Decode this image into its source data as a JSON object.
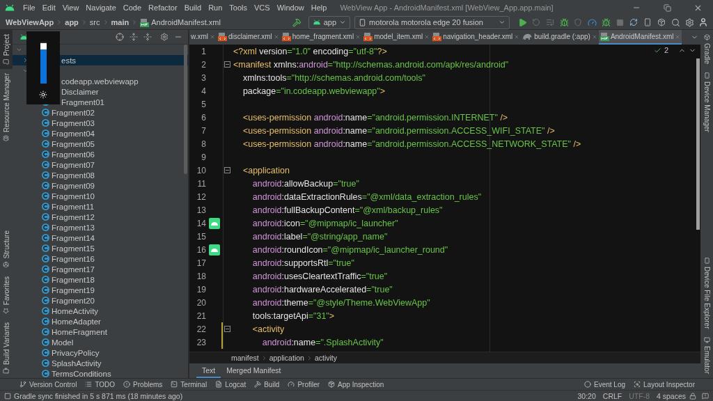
{
  "menu_bar": {
    "items": [
      "File",
      "Edit",
      "View",
      "Navigate",
      "Code",
      "Refactor",
      "Build",
      "Run",
      "Tools",
      "VCS",
      "Window",
      "Help"
    ],
    "title": "WebView App - AndroidManifest.xml [WebView_App.app.main]"
  },
  "navigation_bar": {
    "breadcrumb": [
      "WebViewApp",
      "app",
      "src",
      "main",
      "AndroidManifest.xml"
    ],
    "module": "app",
    "device": "motorola motorola edge 20 fusion"
  },
  "left_strip": {
    "top": [
      {
        "label": "Project",
        "selected": true
      },
      {
        "label": "Resource Manager",
        "selected": false
      }
    ],
    "bottom": [
      {
        "label": "Structure",
        "selected": false
      },
      {
        "label": "Favorites",
        "selected": false
      },
      {
        "label": "Build Variants",
        "selected": false
      }
    ]
  },
  "right_strip": {
    "top": [
      {
        "label": "Gradle"
      },
      {
        "label": "Device Manager"
      }
    ],
    "bottom": [
      {
        "label": "Device File Explorer"
      },
      {
        "label": "Emulator"
      }
    ]
  },
  "brightness_popup": {
    "level": 0.92
  },
  "project_tree": [
    {
      "expanded": true,
      "selected": false,
      "children": [
        {
          "label": "ests",
          "expanded": false,
          "selected": true
        },
        {
          "expanded": true,
          "selected": false,
          "children": [
            {
              "label": "codeapp.webviewapp",
              "selected": false,
              "children": [
                {
                  "label": "Disclaimer",
                  "selected": false
                },
                {
                  "label": "Fragment01",
                  "selected": false
                },
                {
                  "label": "Fragment02",
                  "selected": false
                },
                {
                  "label": "Fragment03",
                  "selected": false
                },
                {
                  "label": "Fragment04",
                  "selected": false
                },
                {
                  "label": "Fragment05",
                  "selected": false
                },
                {
                  "label": "Fragment06",
                  "selected": false
                },
                {
                  "label": "Fragment07",
                  "selected": false
                },
                {
                  "label": "Fragment08",
                  "selected": false
                },
                {
                  "label": "Fragment09",
                  "selected": false
                },
                {
                  "label": "Fragment10",
                  "selected": false
                },
                {
                  "label": "Fragment11",
                  "selected": false
                },
                {
                  "label": "Fragment12",
                  "selected": false
                },
                {
                  "label": "Fragment13",
                  "selected": false
                },
                {
                  "label": "Fragment14",
                  "selected": false
                },
                {
                  "label": "Fragment15",
                  "selected": false
                },
                {
                  "label": "Fragment16",
                  "selected": false
                },
                {
                  "label": "Fragment17",
                  "selected": false
                },
                {
                  "label": "Fragment18",
                  "selected": false
                },
                {
                  "label": "Fragment19",
                  "selected": false
                },
                {
                  "label": "Fragment20",
                  "selected": false
                },
                {
                  "label": "HomeActivity",
                  "selected": false
                },
                {
                  "label": "HomeAdapter",
                  "selected": false
                },
                {
                  "label": "HomeFragment",
                  "selected": false
                },
                {
                  "label": "Model",
                  "selected": false
                },
                {
                  "label": "PrivacyPolicy",
                  "selected": false
                },
                {
                  "label": "SplashActivity",
                  "selected": false
                },
                {
                  "label": "TermsConditions",
                  "selected": false
                }
              ]
            }
          ]
        }
      ]
    }
  ],
  "editor_tabs": [
    {
      "label": "w.xml",
      "kind": "cut",
      "selected": false
    },
    {
      "label": "disclaimer.xml",
      "kind": "xml",
      "selected": false
    },
    {
      "label": "home_fragment.xml",
      "kind": "xml",
      "selected": false
    },
    {
      "label": "model_item.xml",
      "kind": "xml",
      "selected": false
    },
    {
      "label": "navigation_header.xml",
      "kind": "xml",
      "selected": false
    },
    {
      "label": "build.gradle (:app)",
      "kind": "gradle",
      "selected": false
    },
    {
      "label": "AndroidManifest.xml",
      "kind": "manifest",
      "selected": true
    }
  ],
  "inspection_count": "2",
  "code_lines": [
    {
      "number": "1",
      "kind": "plain",
      "changed": false,
      "tokens": [
        {
          "kind": "tag",
          "text": "<?xml"
        },
        {
          "kind": "attr",
          "text": " version"
        },
        {
          "kind": "value",
          "text": "=\"1.0\""
        },
        {
          "kind": "attr",
          "text": " encoding"
        },
        {
          "kind": "value",
          "text": "=\"utf-8\""
        },
        {
          "kind": "tag",
          "text": "?>"
        }
      ]
    },
    {
      "number": "2",
      "kind": "fold",
      "changed": false,
      "tokens": [
        {
          "kind": "tag",
          "text": "<manifest"
        },
        {
          "kind": "attr",
          "text": " xmlns:"
        },
        {
          "kind": "ns",
          "text": "android"
        },
        {
          "kind": "value",
          "text": "=\"http://schemas.android.com/apk/res/android\""
        }
      ]
    },
    {
      "number": "3",
      "kind": "plain",
      "changed": false,
      "tokens": [
        {
          "kind": "attr",
          "text": "    xmlns:tools"
        },
        {
          "kind": "value",
          "text": "=\"http://schemas.android.com/tools\""
        }
      ]
    },
    {
      "number": "4",
      "kind": "plain",
      "changed": false,
      "tokens": [
        {
          "kind": "attr",
          "text": "    package"
        },
        {
          "kind": "value",
          "text": "=\"in.codeapp.webviewapp\""
        },
        {
          "kind": "tag",
          "text": ">"
        }
      ]
    },
    {
      "number": "5",
      "kind": "plain",
      "changed": false
    },
    {
      "number": "6",
      "kind": "plain",
      "changed": false,
      "tokens": [
        {
          "kind": "tag",
          "text": "    <uses-permission"
        },
        {
          "kind": "ns",
          "text": " android"
        },
        {
          "kind": "attr",
          "text": ":name"
        },
        {
          "kind": "value",
          "text": "=\"android.permission.INTERNET\""
        },
        {
          "kind": "tag",
          "text": " />"
        }
      ]
    },
    {
      "number": "7",
      "kind": "plain",
      "changed": false,
      "tokens": [
        {
          "kind": "tag",
          "text": "    <uses-permission"
        },
        {
          "kind": "ns",
          "text": " android"
        },
        {
          "kind": "attr",
          "text": ":name"
        },
        {
          "kind": "value",
          "text": "=\"android.permission.ACCESS_WIFI_STATE\""
        },
        {
          "kind": "tag",
          "text": " />"
        }
      ]
    },
    {
      "number": "8",
      "kind": "plain",
      "changed": false,
      "tokens": [
        {
          "kind": "tag",
          "text": "    <uses-permission"
        },
        {
          "kind": "ns",
          "text": " android"
        },
        {
          "kind": "attr",
          "text": ":name"
        },
        {
          "kind": "value",
          "text": "=\"android.permission.ACCESS_NETWORK_STATE\""
        },
        {
          "kind": "tag",
          "text": " />"
        }
      ]
    },
    {
      "number": "9",
      "kind": "plain",
      "changed": false
    },
    {
      "number": "10",
      "kind": "fold",
      "changed": false,
      "tokens": [
        {
          "kind": "tag",
          "text": "    <application"
        }
      ]
    },
    {
      "number": "11",
      "kind": "plain",
      "changed": false,
      "tokens": [
        {
          "kind": "ns",
          "text": "        android"
        },
        {
          "kind": "attr",
          "text": ":allowBackup"
        },
        {
          "kind": "value",
          "text": "=\"true\""
        }
      ]
    },
    {
      "number": "12",
      "kind": "plain",
      "changed": false,
      "tokens": [
        {
          "kind": "ns",
          "text": "        android"
        },
        {
          "kind": "attr",
          "text": ":dataExtractionRules"
        },
        {
          "kind": "value",
          "text": "=\"@xml/data_extraction_rules\""
        }
      ]
    },
    {
      "number": "13",
      "kind": "plain",
      "changed": false,
      "tokens": [
        {
          "kind": "ns",
          "text": "        android"
        },
        {
          "kind": "attr",
          "text": ":fullBackupContent"
        },
        {
          "kind": "value",
          "text": "=\"@xml/backup_rules\""
        }
      ]
    },
    {
      "number": "14",
      "kind": "android",
      "changed": false,
      "tokens": [
        {
          "kind": "ns",
          "text": "        android"
        },
        {
          "kind": "attr",
          "text": ":icon"
        },
        {
          "kind": "value",
          "text": "=\"@mipmap/ic_launcher\""
        }
      ]
    },
    {
      "number": "15",
      "kind": "plain",
      "changed": false,
      "tokens": [
        {
          "kind": "ns",
          "text": "        android"
        },
        {
          "kind": "attr",
          "text": ":label"
        },
        {
          "kind": "value",
          "text": "=\"@string/app_name\""
        }
      ]
    },
    {
      "number": "16",
      "kind": "android",
      "changed": false,
      "tokens": [
        {
          "kind": "ns",
          "text": "        android"
        },
        {
          "kind": "attr",
          "text": ":roundIcon"
        },
        {
          "kind": "value",
          "text": "=\"@mipmap/ic_launcher_round\""
        }
      ]
    },
    {
      "number": "17",
      "kind": "plain",
      "changed": false,
      "tokens": [
        {
          "kind": "ns",
          "text": "        android"
        },
        {
          "kind": "attr",
          "text": ":supportsRtl"
        },
        {
          "kind": "value",
          "text": "=\"true\""
        }
      ]
    },
    {
      "number": "18",
      "kind": "plain",
      "changed": false,
      "tokens": [
        {
          "kind": "ns",
          "text": "        android"
        },
        {
          "kind": "attr",
          "text": ":usesCleartextTraffic"
        },
        {
          "kind": "value",
          "text": "=\"true\""
        }
      ]
    },
    {
      "number": "19",
      "kind": "plain",
      "changed": false,
      "tokens": [
        {
          "kind": "ns",
          "text": "        android"
        },
        {
          "kind": "attr",
          "text": ":hardwareAccelerated"
        },
        {
          "kind": "value",
          "text": "=\"true\""
        }
      ]
    },
    {
      "number": "20",
      "kind": "plain",
      "changed": false,
      "tokens": [
        {
          "kind": "ns",
          "text": "        android"
        },
        {
          "kind": "attr",
          "text": ":theme"
        },
        {
          "kind": "value",
          "text": "=\"@style/Theme.WebViewApp\""
        }
      ]
    },
    {
      "number": "21",
      "kind": "plain",
      "changed": false,
      "tokens": [
        {
          "kind": "attr",
          "text": "        tools:targetApi"
        },
        {
          "kind": "value",
          "text": "=\"31\""
        },
        {
          "kind": "tag",
          "text": ">"
        }
      ]
    },
    {
      "number": "22",
      "kind": "fold",
      "changed": true,
      "tokens": [
        {
          "kind": "tag",
          "text": "        <activity"
        }
      ]
    },
    {
      "number": "23",
      "kind": "plain",
      "changed": true,
      "tokens": [
        {
          "kind": "ns",
          "text": "            android"
        },
        {
          "kind": "attr",
          "text": ":name"
        },
        {
          "kind": "value",
          "text": "=\".SplashActivity\""
        }
      ]
    }
  ],
  "editor_breadcrumb": [
    "manifest",
    "application",
    "activity"
  ],
  "editor_mode_tabs": [
    {
      "label": "Text",
      "selected": true
    },
    {
      "label": "Merged Manifest",
      "selected": false
    }
  ],
  "tool_window_bar": {
    "left": [
      "Version Control",
      "TODO",
      "Problems",
      "Terminal",
      "Logcat",
      "Build",
      "Profiler",
      "App Inspection"
    ],
    "right": [
      "Event Log",
      "Layout Inspector"
    ]
  },
  "status_bar": {
    "message": "Gradle sync finished in 5 s 871 ms (18 minutes ago)",
    "items": [
      {
        "label": "30:20",
        "disabled": false
      },
      {
        "label": "CRLF",
        "disabled": false
      },
      {
        "label": "UTF-8",
        "disabled": true
      },
      {
        "label": "4 spaces",
        "disabled": false
      }
    ]
  }
}
